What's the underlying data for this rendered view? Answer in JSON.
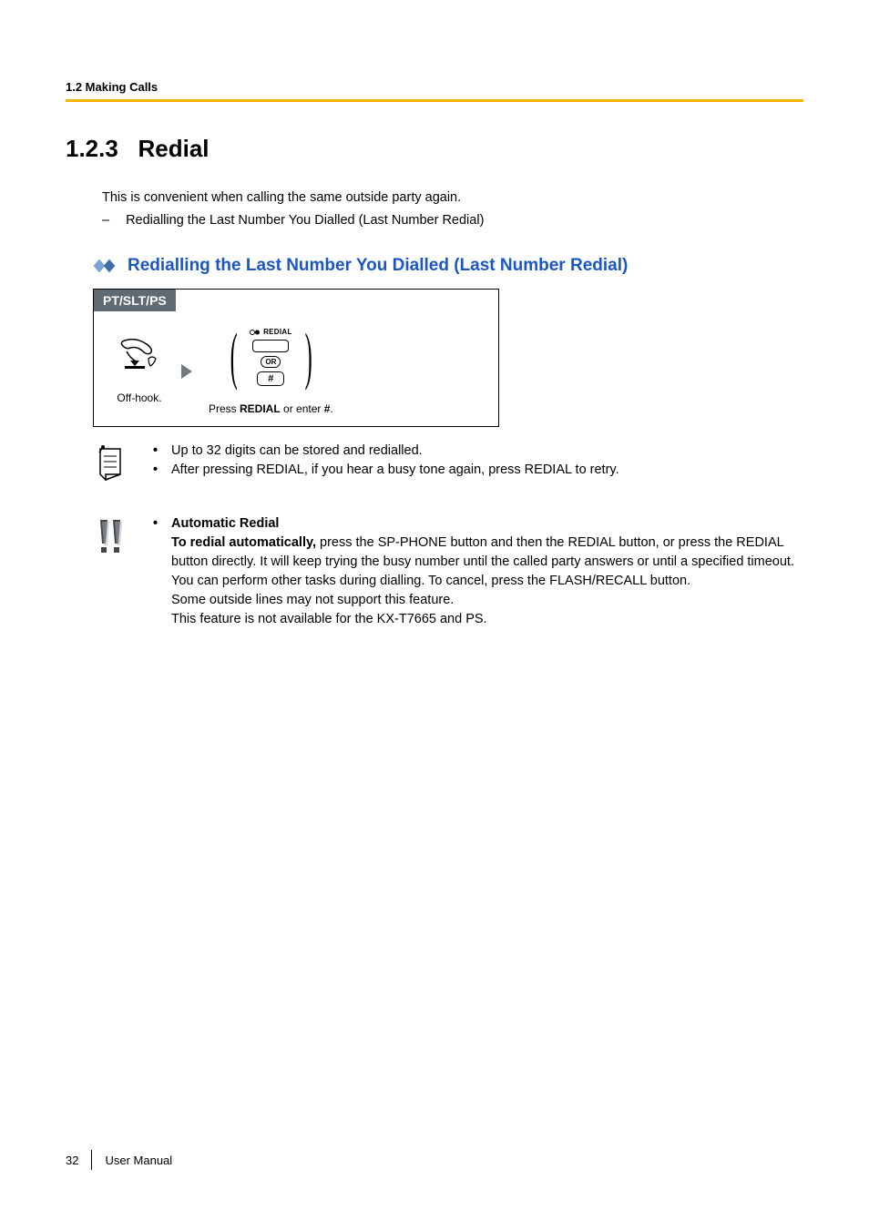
{
  "header": {
    "running_head": "1.2 Making Calls"
  },
  "section": {
    "number": "1.2.3",
    "title": "Redial",
    "intro": "This is convenient when calling the same outside party again.",
    "dash": "–",
    "dash_item": "Redialling the Last Number You Dialled (Last Number Redial)"
  },
  "subsection": {
    "title": "Redialling the Last Number You Dialled (Last Number Redial)"
  },
  "procedure": {
    "tab": "PT/SLT/PS",
    "step1_caption": "Off-hook.",
    "redial_label": "REDIAL",
    "or_label": "OR",
    "hash_label": "#",
    "step2_caption_pre": "Press ",
    "step2_caption_bold": "REDIAL",
    "step2_caption_mid": " or enter ",
    "step2_caption_bold2": "#",
    "step2_caption_post": "."
  },
  "note1": {
    "b1": "Up to 32 digits can be stored and redialled.",
    "b2": "After pressing REDIAL, if you hear a busy tone again, press REDIAL to retry."
  },
  "note2": {
    "heading": "Automatic Redial",
    "p1_bold": "To redial automatically,",
    "p1_rest": " press the SP-PHONE button and then the REDIAL button, or press the REDIAL button directly. It will keep trying the busy number until the called party answers or until a specified timeout.",
    "p2": "You can perform other tasks during dialling. To cancel, press the FLASH/RECALL button.",
    "p3": "Some outside lines may not support this feature.",
    "p4": "This feature is not available for the KX-T7665 and PS."
  },
  "footer": {
    "page_number": "32",
    "doc_title": "User Manual"
  }
}
